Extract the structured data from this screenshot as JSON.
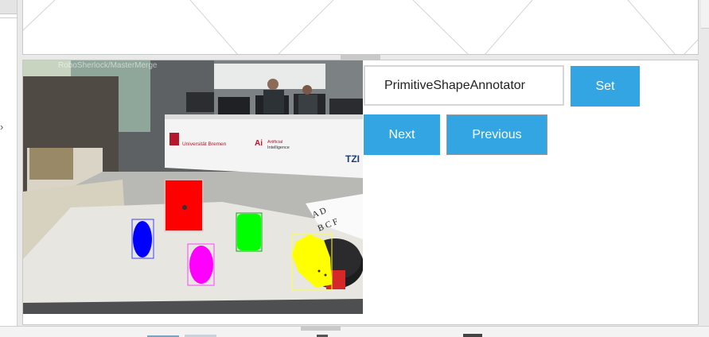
{
  "camera": {
    "overlay_caption": "RoboSherlock/MasterMerge",
    "banner_left": "Universität Bremen",
    "banner_ai": "Artificial",
    "banner_ai2": "Intelligence",
    "banner_tzi": "TZI"
  },
  "annotator": {
    "input_value": "PrimitiveShapeAnnotator",
    "set_label": "Set",
    "next_label": "Next",
    "previous_label": "Previous"
  },
  "colors": {
    "accent": "#33a5e3",
    "segment_red": "#ff0000",
    "segment_blue": "#0000ff",
    "segment_green": "#00ff00",
    "segment_magenta": "#ff00ff",
    "segment_yellow": "#ffff00"
  }
}
